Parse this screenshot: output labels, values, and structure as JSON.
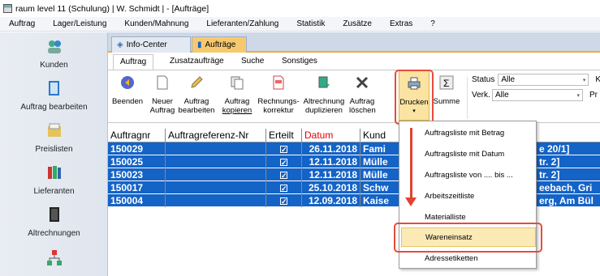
{
  "window": {
    "title": "raum level 11 (Schulung) | W. Schmidt | - [Aufträge]"
  },
  "menu": [
    "Auftrag",
    "Lager/Leistung",
    "Kunden/Mahnung",
    "Lieferanten/Zahlung",
    "Statistik",
    "Zusätze",
    "Extras",
    "?"
  ],
  "sidebar": {
    "items": [
      {
        "label": "Kunden",
        "icon": "users-icon"
      },
      {
        "label": "Auftrag bearbeiten",
        "icon": "document-icon"
      },
      {
        "label": "Preislisten",
        "icon": "folder-icon"
      },
      {
        "label": "Lieferanten",
        "icon": "books-icon"
      },
      {
        "label": "Altrechnungen",
        "icon": "binder-icon"
      },
      {
        "label": "",
        "icon": "network-icon"
      }
    ]
  },
  "doc_tabs": {
    "info": "Info-Center",
    "auftraege": "Aufträge"
  },
  "ribbon_tabs": [
    "Auftrag",
    "Zusatzaufträge",
    "Suche",
    "Sonstiges"
  ],
  "ribbon": {
    "beenden": "Beenden",
    "neuer": [
      "Neuer",
      "Auftrag"
    ],
    "auftrag_bearbeiten": [
      "Auftrag",
      "bearbeiten"
    ],
    "auftrag_kopieren": [
      "Auftrag",
      "kopieren"
    ],
    "rechnungskorrektur": [
      "Rechnungs-",
      "korrektur"
    ],
    "altrechnung": [
      "Altrechnung",
      "duplizieren"
    ],
    "auftrag_loeschen": [
      "Auftrag",
      "löschen"
    ],
    "drucken": "Drucken",
    "summe": "Summe",
    "status_label": "Status",
    "status_value": "Alle",
    "verk_label": "Verk.",
    "verk_value": "Alle",
    "ka": "Ka",
    "pr": "Pr"
  },
  "table": {
    "columns": [
      "Auftragnr",
      "Auftragreferenz-Nr",
      "Erteilt",
      "Datum",
      "Kund"
    ],
    "rows": [
      {
        "nr": "150029",
        "ref": "",
        "datum": "26.11.2018",
        "kunde": "Fami",
        "rest": "e 20/1]"
      },
      {
        "nr": "150025",
        "ref": "",
        "datum": "12.11.2018",
        "kunde": "Mülle",
        "rest": "tr. 2]"
      },
      {
        "nr": "150023",
        "ref": "",
        "datum": "12.11.2018",
        "kunde": "Mülle",
        "rest": "tr. 2]"
      },
      {
        "nr": "150017",
        "ref": "",
        "datum": "25.10.2018",
        "kunde": "Schw",
        "rest": "eebach, Gri"
      },
      {
        "nr": "150004",
        "ref": "",
        "datum": "12.09.2018",
        "kunde": "Kaise",
        "rest": "erg, Am Bül"
      }
    ]
  },
  "print_menu": {
    "items": [
      "Auftragsliste mit Betrag",
      "Auftragsliste mit Datum",
      "Auftragsliste von .... bis ...",
      "Arbeitszeitliste",
      "Materialliste",
      "Wareneinsatz",
      "Adressetiketten"
    ],
    "selected": "Wareneinsatz"
  },
  "colors": {
    "selection": "#1463c7",
    "highlight": "#e64c3c",
    "accent_tab": "#f7c96e"
  }
}
